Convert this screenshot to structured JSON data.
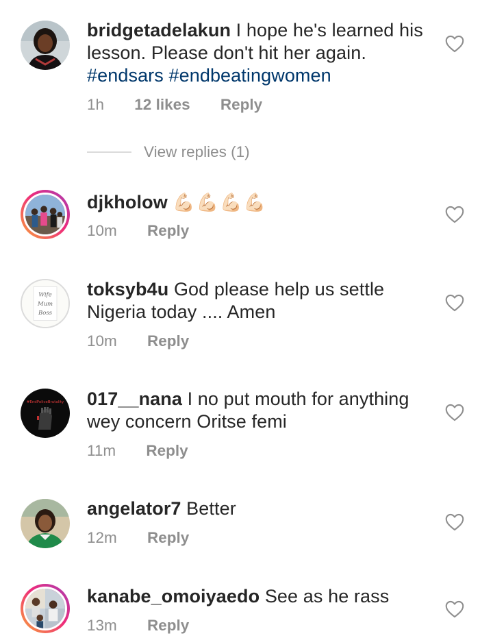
{
  "comments": [
    {
      "username": "bridgetadelakun",
      "text": "I hope he's learned his lesson. Please don't hit her again.",
      "hashtags": "#endsars #endbeatingwomen",
      "time": "1h",
      "likes": "12 likes",
      "reply": "Reply",
      "view_replies": "View replies (1)"
    },
    {
      "username": "djkholow",
      "text": "💪🏻💪🏻💪🏻💪🏻",
      "time": "10m",
      "reply": "Reply"
    },
    {
      "username": "toksyb4u",
      "text": "God please help us settle Nigeria today .... Amen",
      "time": "10m",
      "reply": "Reply",
      "avatar_text": [
        "Wife",
        "Mum",
        "Boss"
      ]
    },
    {
      "username": "017__nana",
      "text": "I no put mouth for anything wey concern Oritse femi",
      "time": "11m",
      "reply": "Reply",
      "avatar_text": "#EndPoliceBrutality"
    },
    {
      "username": "angelator7",
      "text": "Better",
      "time": "12m",
      "reply": "Reply"
    },
    {
      "username": "kanabe_omoiyaedo",
      "text": "See as he rass",
      "time": "13m",
      "reply": "Reply"
    }
  ],
  "icons": {
    "like": "heart-outline-icon"
  },
  "colors": {
    "text": "#262626",
    "secondary": "#8e8e8e",
    "hashtag": "#00376b",
    "story_ring_start": "#f9a53a",
    "story_ring_end": "#ee2a7b"
  }
}
